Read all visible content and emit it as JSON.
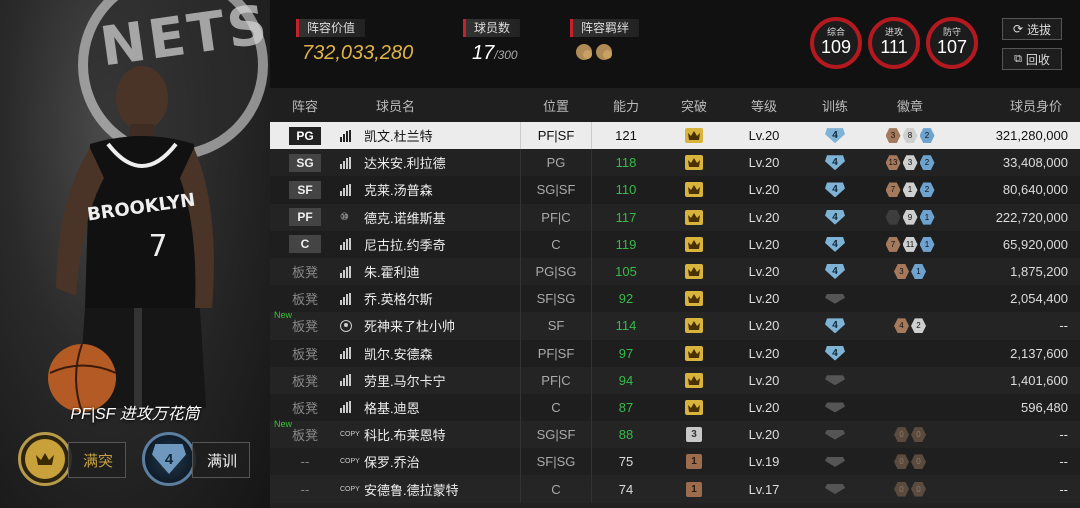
{
  "hero": {
    "logo_text": "NETS",
    "caption": "PF|SF 进攻万花筒",
    "full_break_label": "满突",
    "full_train_value": "4",
    "full_train_label": "满训"
  },
  "header": {
    "lineup_value_label": "阵容价值",
    "lineup_value": "732,033,280",
    "player_count_label": "球员数",
    "player_count": "17",
    "player_count_max": "/300",
    "chemistry_label": "阵容羁绊",
    "rings": {
      "overall": {
        "label": "综合",
        "value": "109"
      },
      "offense": {
        "label": "进攻",
        "value": "111"
      },
      "defense": {
        "label": "防守",
        "value": "107"
      }
    },
    "scout_label": "选拔",
    "recycle_label": "回收"
  },
  "table": {
    "headers": {
      "lineup": "阵容",
      "name": "球员名",
      "position": "位置",
      "ability": "能力",
      "breakthrough": "突破",
      "level": "等级",
      "training": "训练",
      "badges": "徽章",
      "worth": "球员身价"
    },
    "rows": [
      {
        "slot": "PG",
        "bench": false,
        "new": false,
        "icon": "bars",
        "name": "凯文.杜兰特",
        "position": "PF|SF",
        "ability": "121",
        "break": "crown",
        "level": "Lv.20",
        "train": "4",
        "badges": [
          [
            "bronze",
            "3"
          ],
          [
            "silver",
            "8"
          ],
          [
            "blue",
            "2"
          ]
        ],
        "worth": "321,280,000",
        "selected": true
      },
      {
        "slot": "SG",
        "bench": false,
        "new": false,
        "icon": "bars",
        "name": "达米安.利拉德",
        "position": "PG",
        "ability": "118",
        "break": "crown",
        "level": "Lv.20",
        "train": "4",
        "badges": [
          [
            "bronze",
            "13"
          ],
          [
            "silver",
            "3"
          ],
          [
            "blue",
            "2"
          ]
        ],
        "worth": "33,408,000"
      },
      {
        "slot": "SF",
        "bench": false,
        "new": false,
        "icon": "bars",
        "name": "克莱.汤普森",
        "position": "SG|SF",
        "ability": "110",
        "break": "crown",
        "level": "Lv.20",
        "train": "4",
        "badges": [
          [
            "bronze",
            "7"
          ],
          [
            "silver",
            "1"
          ],
          [
            "blue",
            "2"
          ]
        ],
        "worth": "80,640,000"
      },
      {
        "slot": "PF",
        "bench": false,
        "new": false,
        "icon": "ten",
        "name": "德克.诺维斯基",
        "position": "PF|C",
        "ability": "117",
        "break": "crown",
        "level": "Lv.20",
        "train": "4",
        "badges": [
          [
            "dark",
            "0"
          ],
          [
            "silver",
            "9"
          ],
          [
            "blue",
            "1"
          ]
        ],
        "worth": "222,720,000"
      },
      {
        "slot": "C",
        "bench": false,
        "new": false,
        "icon": "bars",
        "name": "尼古拉.约季奇",
        "position": "C",
        "ability": "119",
        "break": "crown",
        "level": "Lv.20",
        "train": "4",
        "badges": [
          [
            "bronze",
            "7"
          ],
          [
            "silver",
            "11"
          ],
          [
            "blue",
            "1"
          ]
        ],
        "worth": "65,920,000"
      },
      {
        "slot": "板凳",
        "bench": true,
        "new": false,
        "icon": "bars",
        "name": "朱.霍利迪",
        "position": "PG|SG",
        "ability": "105",
        "break": "crown",
        "level": "Lv.20",
        "train": "4",
        "badges": [
          [
            "bronze",
            "3"
          ],
          [
            "blue",
            "1"
          ]
        ],
        "worth": "1,875,200"
      },
      {
        "slot": "板凳",
        "bench": true,
        "new": false,
        "icon": "bars",
        "name": "乔.英格尔斯",
        "position": "SF|SG",
        "ability": "92",
        "break": "crown",
        "level": "Lv.20",
        "train": "",
        "badges": [],
        "worth": "2,054,400"
      },
      {
        "slot": "板凳",
        "bench": true,
        "new": true,
        "new_label": "New",
        "icon": "person",
        "name": "死神来了杜小帅",
        "position": "SF",
        "ability": "114",
        "break": "crown",
        "level": "Lv.20",
        "train": "4",
        "badges": [
          [
            "bronze",
            "4"
          ],
          [
            "silver",
            "2"
          ]
        ],
        "worth": "--"
      },
      {
        "slot": "板凳",
        "bench": true,
        "new": false,
        "icon": "bars",
        "name": "凯尔.安德森",
        "position": "PF|SF",
        "ability": "97",
        "break": "crown",
        "level": "Lv.20",
        "train": "4",
        "badges": [],
        "worth": "2,137,600"
      },
      {
        "slot": "板凳",
        "bench": true,
        "new": false,
        "icon": "bars",
        "name": "劳里.马尔卡宁",
        "position": "PF|C",
        "ability": "94",
        "break": "crown",
        "level": "Lv.20",
        "train": "",
        "badges": [],
        "worth": "1,401,600"
      },
      {
        "slot": "板凳",
        "bench": true,
        "new": false,
        "icon": "bars",
        "name": "格基.迪恩",
        "position": "C",
        "ability": "87",
        "break": "crown",
        "level": "Lv.20",
        "train": "",
        "badges": [],
        "worth": "596,480"
      },
      {
        "slot": "板凳",
        "bench": true,
        "new": true,
        "new_label": "New",
        "icon": "copy",
        "name": "科比.布莱恩特",
        "position": "SG|SF",
        "ability": "88",
        "break": "3",
        "level": "Lv.20",
        "train": "",
        "badges": [
          [
            "dim",
            "0"
          ],
          [
            "dim",
            "0"
          ]
        ],
        "worth": "--"
      },
      {
        "slot": "--",
        "bench": true,
        "new": false,
        "icon": "copy",
        "name": "保罗.乔治",
        "position": "SF|SG",
        "ability": "75",
        "break": "1",
        "level": "Lv.19",
        "train": "",
        "badges": [
          [
            "dim",
            "0"
          ],
          [
            "dim",
            "0"
          ]
        ],
        "worth": "--"
      },
      {
        "slot": "--",
        "bench": true,
        "new": false,
        "icon": "copy",
        "name": "安德鲁.德拉蒙特",
        "position": "C",
        "ability": "74",
        "break": "1",
        "level": "Lv.17",
        "train": "",
        "badges": [
          [
            "dim",
            "0"
          ],
          [
            "dim",
            "0"
          ]
        ],
        "worth": "--"
      }
    ]
  }
}
